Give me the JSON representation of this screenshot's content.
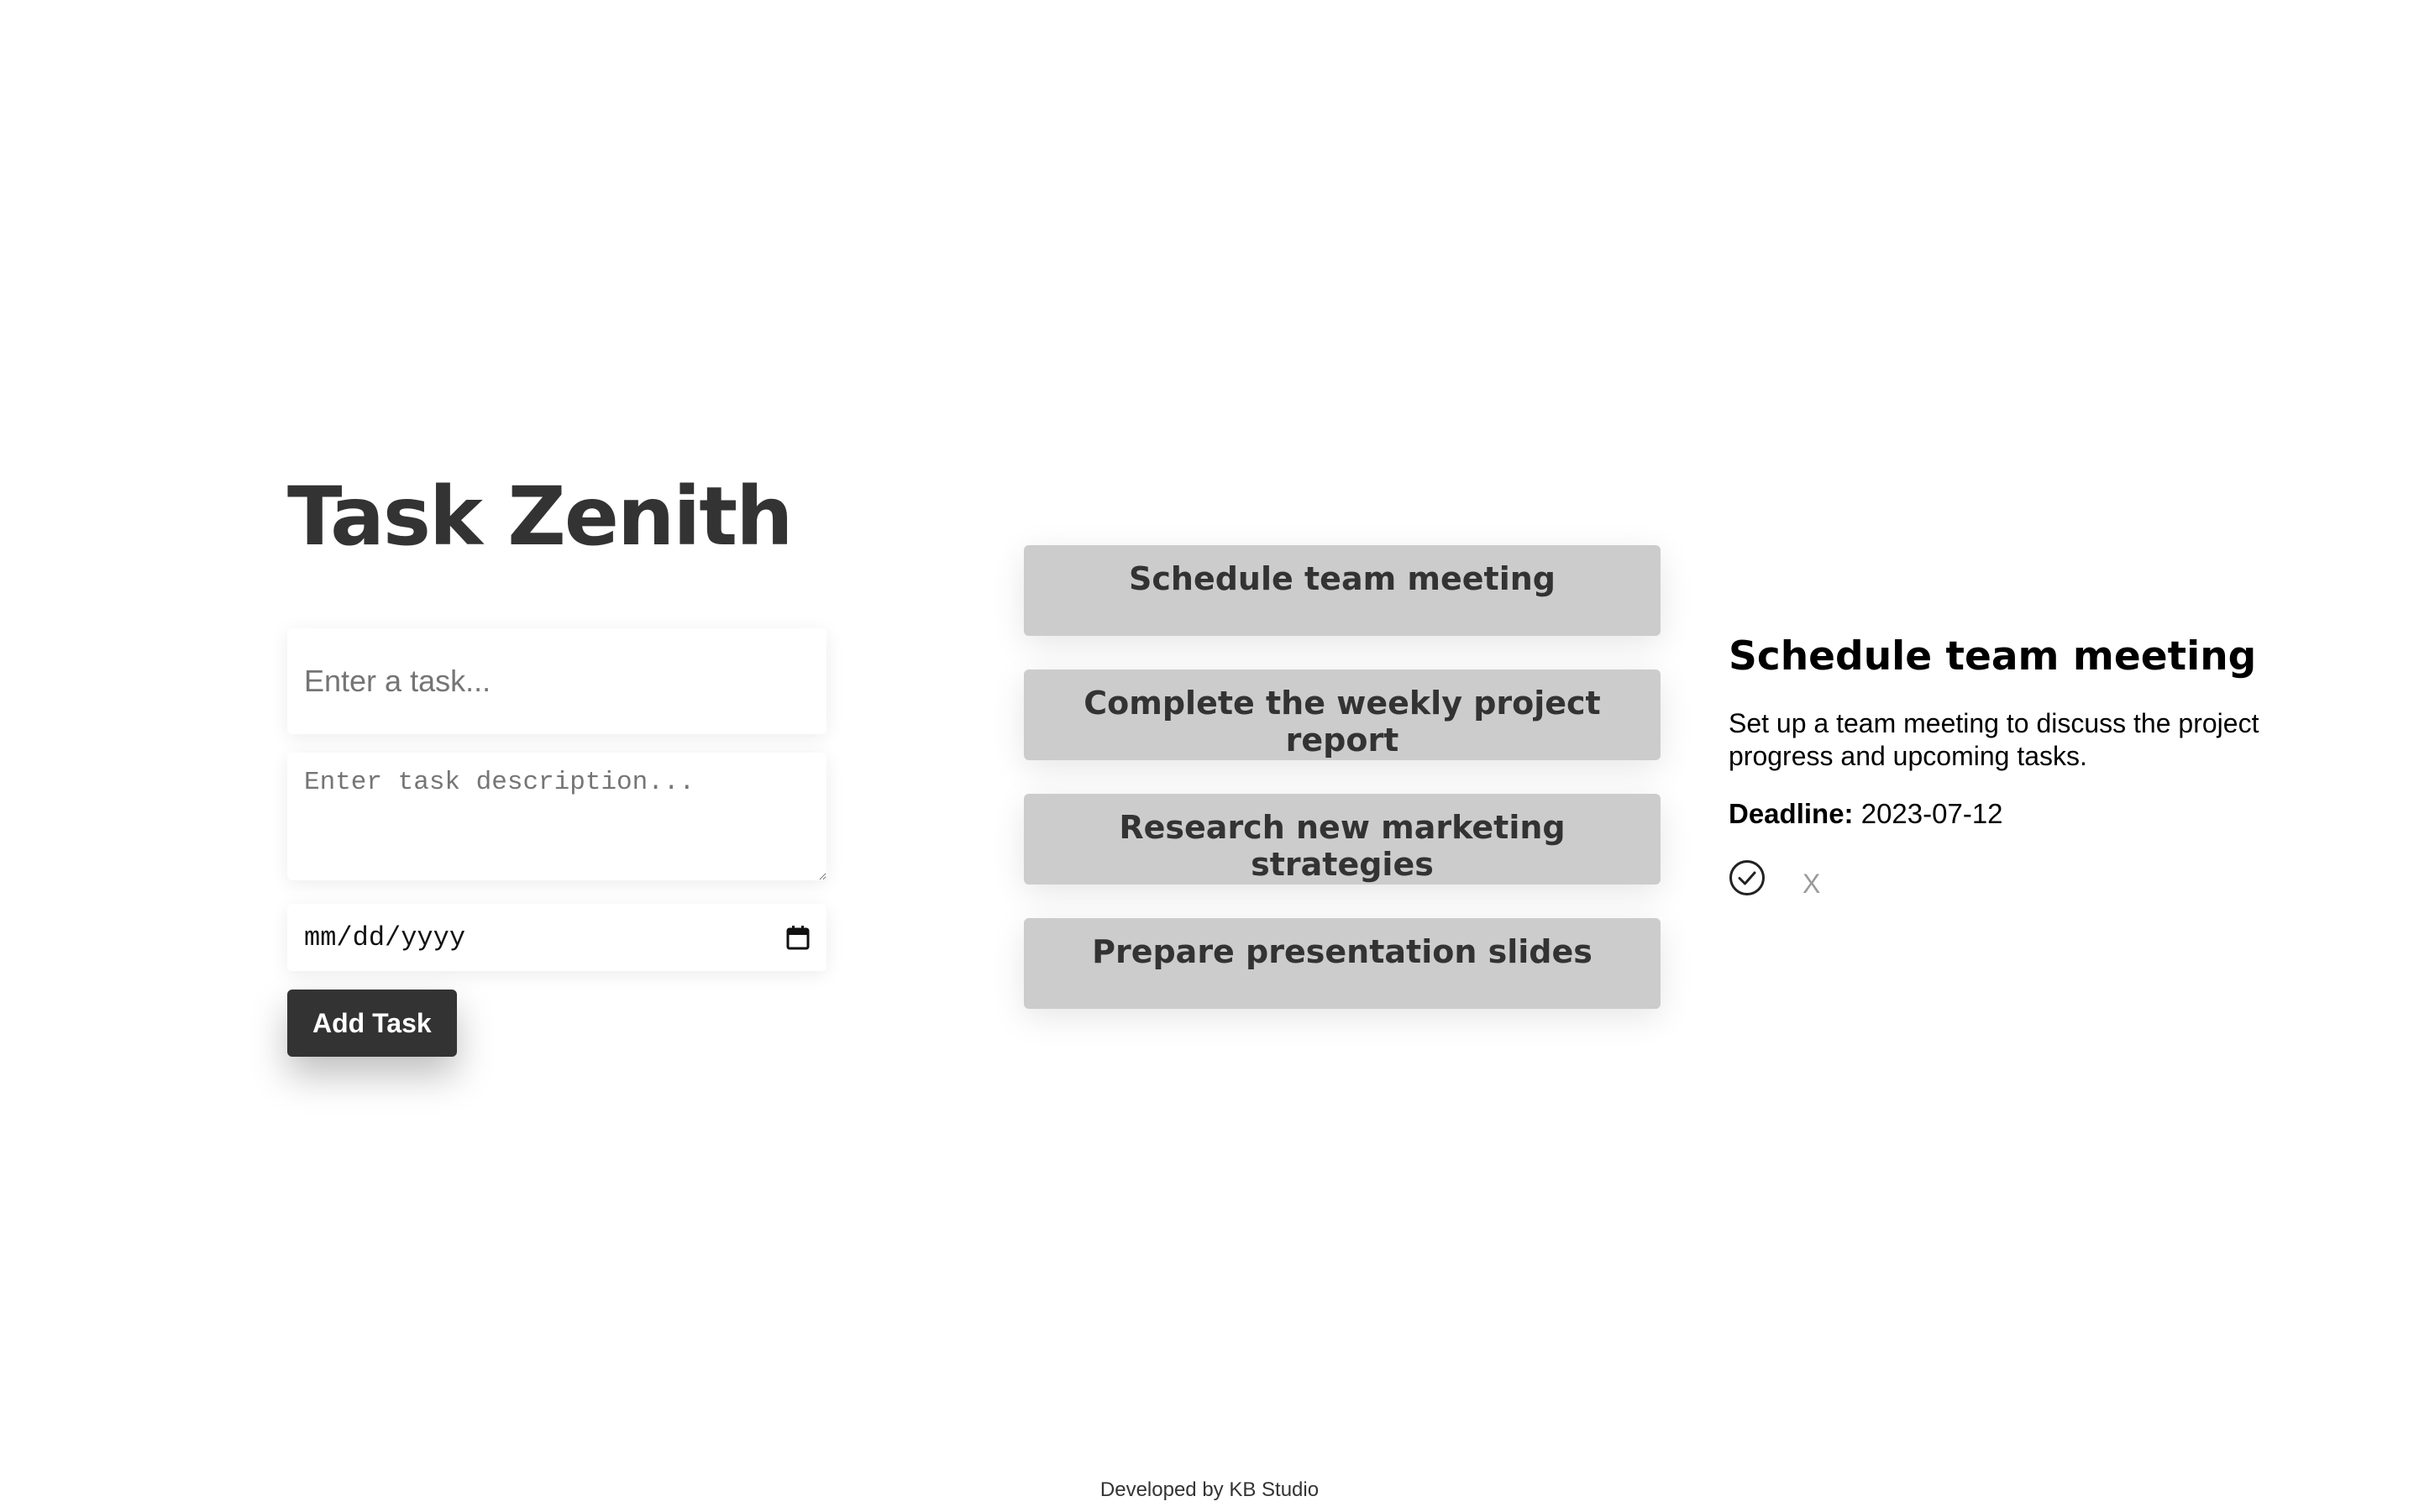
{
  "app": {
    "title": "Task Zenith"
  },
  "form": {
    "task_placeholder": "Enter a task...",
    "description_placeholder": "Enter task description...",
    "date_placeholder": "mm/dd/yyyy",
    "add_label": "Add Task"
  },
  "tasks": [
    {
      "title": "Schedule team meeting"
    },
    {
      "title": "Complete the weekly project report"
    },
    {
      "title": "Research new marketing strategies"
    },
    {
      "title": "Prepare presentation slides"
    }
  ],
  "details": {
    "title": "Schedule team meeting",
    "description": "Set up a team meeting to discuss the project progress and upcoming tasks.",
    "deadline_label": "Deadline:",
    "deadline_value": "2023-07-12",
    "complete_icon": "check-circle-icon",
    "delete_label": "X"
  },
  "footer": {
    "text": "Developed by KB Studio"
  },
  "colors": {
    "primary_text": "#333333",
    "task_item_bg": "#cccccc",
    "button_bg": "#333333",
    "button_text": "#ffffff",
    "muted": "#9a9a9a"
  }
}
